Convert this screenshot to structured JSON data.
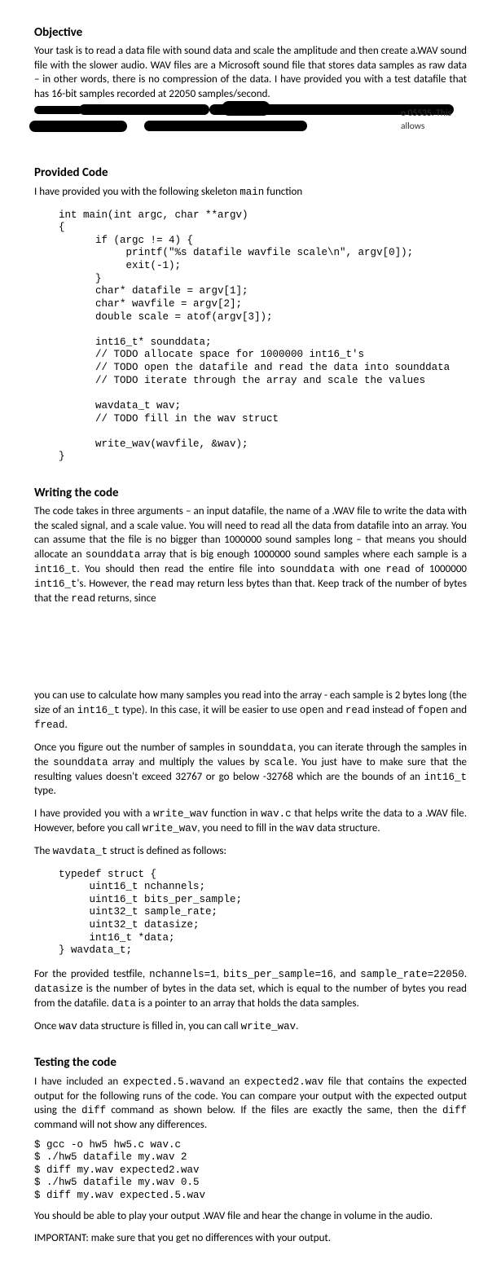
{
  "objective": {
    "heading": "Objective",
    "para1": "Your task is to read a data file with sound data and scale the amplitude and then create a.WAV sound file with the slower audio. WAV files are a Microsoft sound file that stores data samples as raw data – in other words, there is no compression of the data. I have provided you with a test datafile that has 16-bit samples recorded at 22050 samples/second.",
    "frag1": "o 05535. This allows"
  },
  "provided_code": {
    "heading": "Provided Code",
    "intro_pre": "I have provided you with the following skeleton ",
    "intro_code": "main",
    "intro_post": " function",
    "code": "int main(int argc, char **argv)\n{\n      if (argc != 4) {\n           printf(\"%s datafile wavfile scale\\n\", argv[0]);\n           exit(-1);\n      }\n      char* datafile = argv[1];\n      char* wavfile = argv[2];\n      double scale = atof(argv[3]);\n\n      int16_t* sounddata;\n      // TODO allocate space for 1000000 int16_t's\n      // TODO open the datafile and read the data into sounddata\n      // TODO iterate through the array and scale the values\n\n      wavdata_t wav;\n      // TODO fill in the wav struct\n\n      write_wav(wavfile, &wav);\n}"
  },
  "writing": {
    "heading": "Writing the code",
    "p1a": "The code takes in three arguments – an input datafile, the name of a .WAV file to write the data with the scaled signal, and a scale value. You will need to read all the data from datafile into an array. You can assume that the file is no bigger than 1000000 sound samples long – that means you should allocate an ",
    "p1b": "sounddata",
    "p1c": " array that is big enough 1000000 sound samples where each sample is a ",
    "p1d": "int16_t",
    "p1e": ". You should then read the entire file into ",
    "p1f": "sounddata",
    "p1g": " with one ",
    "p1h": "read",
    "p1i": " of 1000000 ",
    "p1j": "int16_t",
    "p1k": "'s. However, the ",
    "p1l": "read",
    "p1m": " may return less bytes than that. Keep track of the number of bytes that the ",
    "p1n": "read",
    "p1o": " returns, since",
    "p2a": "you can use to calculate how many samples you read into the array - each sample is 2 bytes long (the size of an ",
    "p2b": "int16_t",
    "p2c": " type). In this case, it will be easier to use ",
    "p2d": "open",
    "p2e": " and ",
    "p2f": "read",
    "p2g": " instead of ",
    "p2h": "fopen",
    "p2i": " and ",
    "p2j": "fread",
    "p2k": ".",
    "p3a": "Once you figure out the number of samples in ",
    "p3b": "sounddata",
    "p3c": ", you can iterate through the samples in the ",
    "p3d": "sounddata",
    "p3e": " array and multiply the values by ",
    "p3f": "scale",
    "p3g": ". You just have to make sure that the resulting values doesn't exceed 32767 or go below -32768 which are the bounds of an ",
    "p3h": "int16_t",
    "p3i": " type.",
    "p4a": "I have provided you with a ",
    "p4b": "write_wav",
    "p4c": " function in ",
    "p4d": "wav.c",
    "p4e": " that helps write the data to a .WAV file. However, before you call ",
    "p4f": "write_wav",
    "p4g": ", you need to fill in the ",
    "p4h": "wav",
    "p4i": " data structure.",
    "p5a": "The ",
    "p5b": "wavdata_t",
    "p5c": " struct is defined as follows:",
    "struct_code": "typedef struct {\n     uint16_t nchannels;\n     uint16_t bits_per_sample;\n     uint32_t sample_rate;\n     uint32_t datasize;\n     int16_t *data;\n} wavdata_t;",
    "p6a": "For the provided testfile, ",
    "p6b": "nchannels=1",
    "p6c": ", ",
    "p6d": "bits_per_sample=16",
    "p6e": ", and ",
    "p6f": "sample_rate=22050",
    "p6g": ". ",
    "p6h": "datasize",
    "p6i": " is the number of bytes in the data set, which is equal to the number of bytes you read from the datafile. ",
    "p6j": "data",
    "p6k": " is a pointer to an array that holds the data samples.",
    "p7a": "Once ",
    "p7b": "wav",
    "p7c": " data structure is filled in, you can call ",
    "p7d": "write_wav",
    "p7e": "."
  },
  "testing": {
    "heading": "Testing the code",
    "p1a": "I have included an ",
    "p1b": "expected.5.wav",
    "p1c": "and an ",
    "p1d": "expected2.wav",
    "p1e": " file that contains the expected output for the following runs of the code.   You can compare your output with the expected output using the ",
    "p1f": "diff",
    "p1g": " command as shown below.  If the files are exactly the same, then the ",
    "p1h": "diff",
    "p1i": " command will not show any differences.",
    "cmd": "$ gcc -o hw5 hw5.c wav.c\n$ ./hw5 datafile my.wav 2\n$ diff my.wav expected2.wav\n$ ./hw5 datafile my.wav 0.5\n$ diff my.wav expected.5.wav",
    "p2": "You should be able to play your output .WAV file and hear the change in volume in the audio.",
    "p3": "IMPORTANT: make sure that you get no differences with your output."
  }
}
